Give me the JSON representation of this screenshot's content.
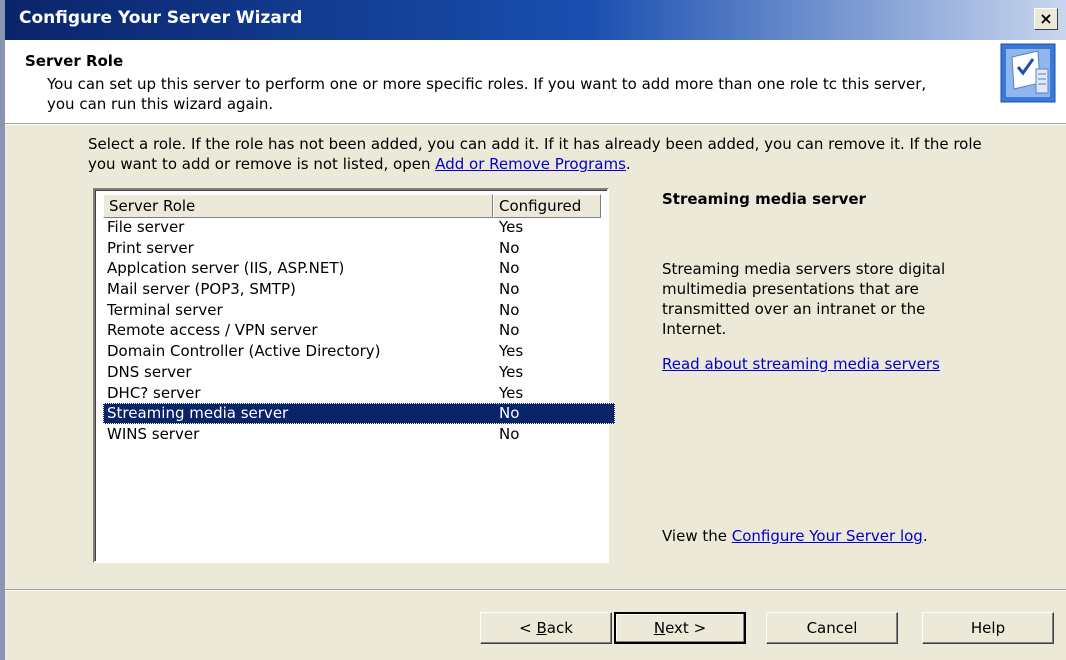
{
  "window": {
    "title": "Configure Your Server Wizard",
    "close_glyph": "×"
  },
  "header": {
    "title": "Server Role",
    "subtitle": "You can set up this server to perform one or more specific roles. If you want to add more than one role tc this server, you can run this wizard again.",
    "icon": "server-checklist-icon"
  },
  "instructions": {
    "text": "Select a role. If the role has not been added, you can add it. If it has already been added, you can remove it. If the role you want to add or remove is not listed, open ",
    "link": "Add or Remove Programs",
    "end": "."
  },
  "roles_list": {
    "columns": [
      "Server Role",
      "Configured"
    ],
    "rows": [
      {
        "role": "File server",
        "configured": "Yes"
      },
      {
        "role": "Print server",
        "configured": "No"
      },
      {
        "role": "Applcation server (IIS, ASP.NET)",
        "configured": "No"
      },
      {
        "role": "Mail server (POP3, SMTP)",
        "configured": "No"
      },
      {
        "role": "Terminal server",
        "configured": "No"
      },
      {
        "role": "Remote access / VPN server",
        "configured": "No"
      },
      {
        "role": "Domain Controller (Active Directory)",
        "configured": "Yes"
      },
      {
        "role": "DNS server",
        "configured": "Yes"
      },
      {
        "role": "DHC? server",
        "configured": "Yes"
      },
      {
        "role": "Streaming media server",
        "configured": "No"
      },
      {
        "role": "WINS server",
        "configured": "No"
      }
    ],
    "selected_index": 9
  },
  "description": {
    "title": "Streaming media server",
    "text": "Streaming media servers store digital multimedia presentations that are transmitted over an intranet or the Internet.",
    "link": "Read about streaming media servers"
  },
  "log": {
    "prefix": "View the ",
    "link": "Configure Your Server log",
    "suffix": "."
  },
  "buttons": {
    "back": {
      "pre": "< ",
      "key": "B",
      "rest": "ack"
    },
    "next": {
      "key": "N",
      "rest": "ext >"
    },
    "cancel": "Cancel",
    "help": "Help"
  },
  "colors": {
    "titlebar": "#0a246a",
    "face": "#ECE9D8",
    "selection": "#0a246a",
    "link": "#0000cc"
  }
}
